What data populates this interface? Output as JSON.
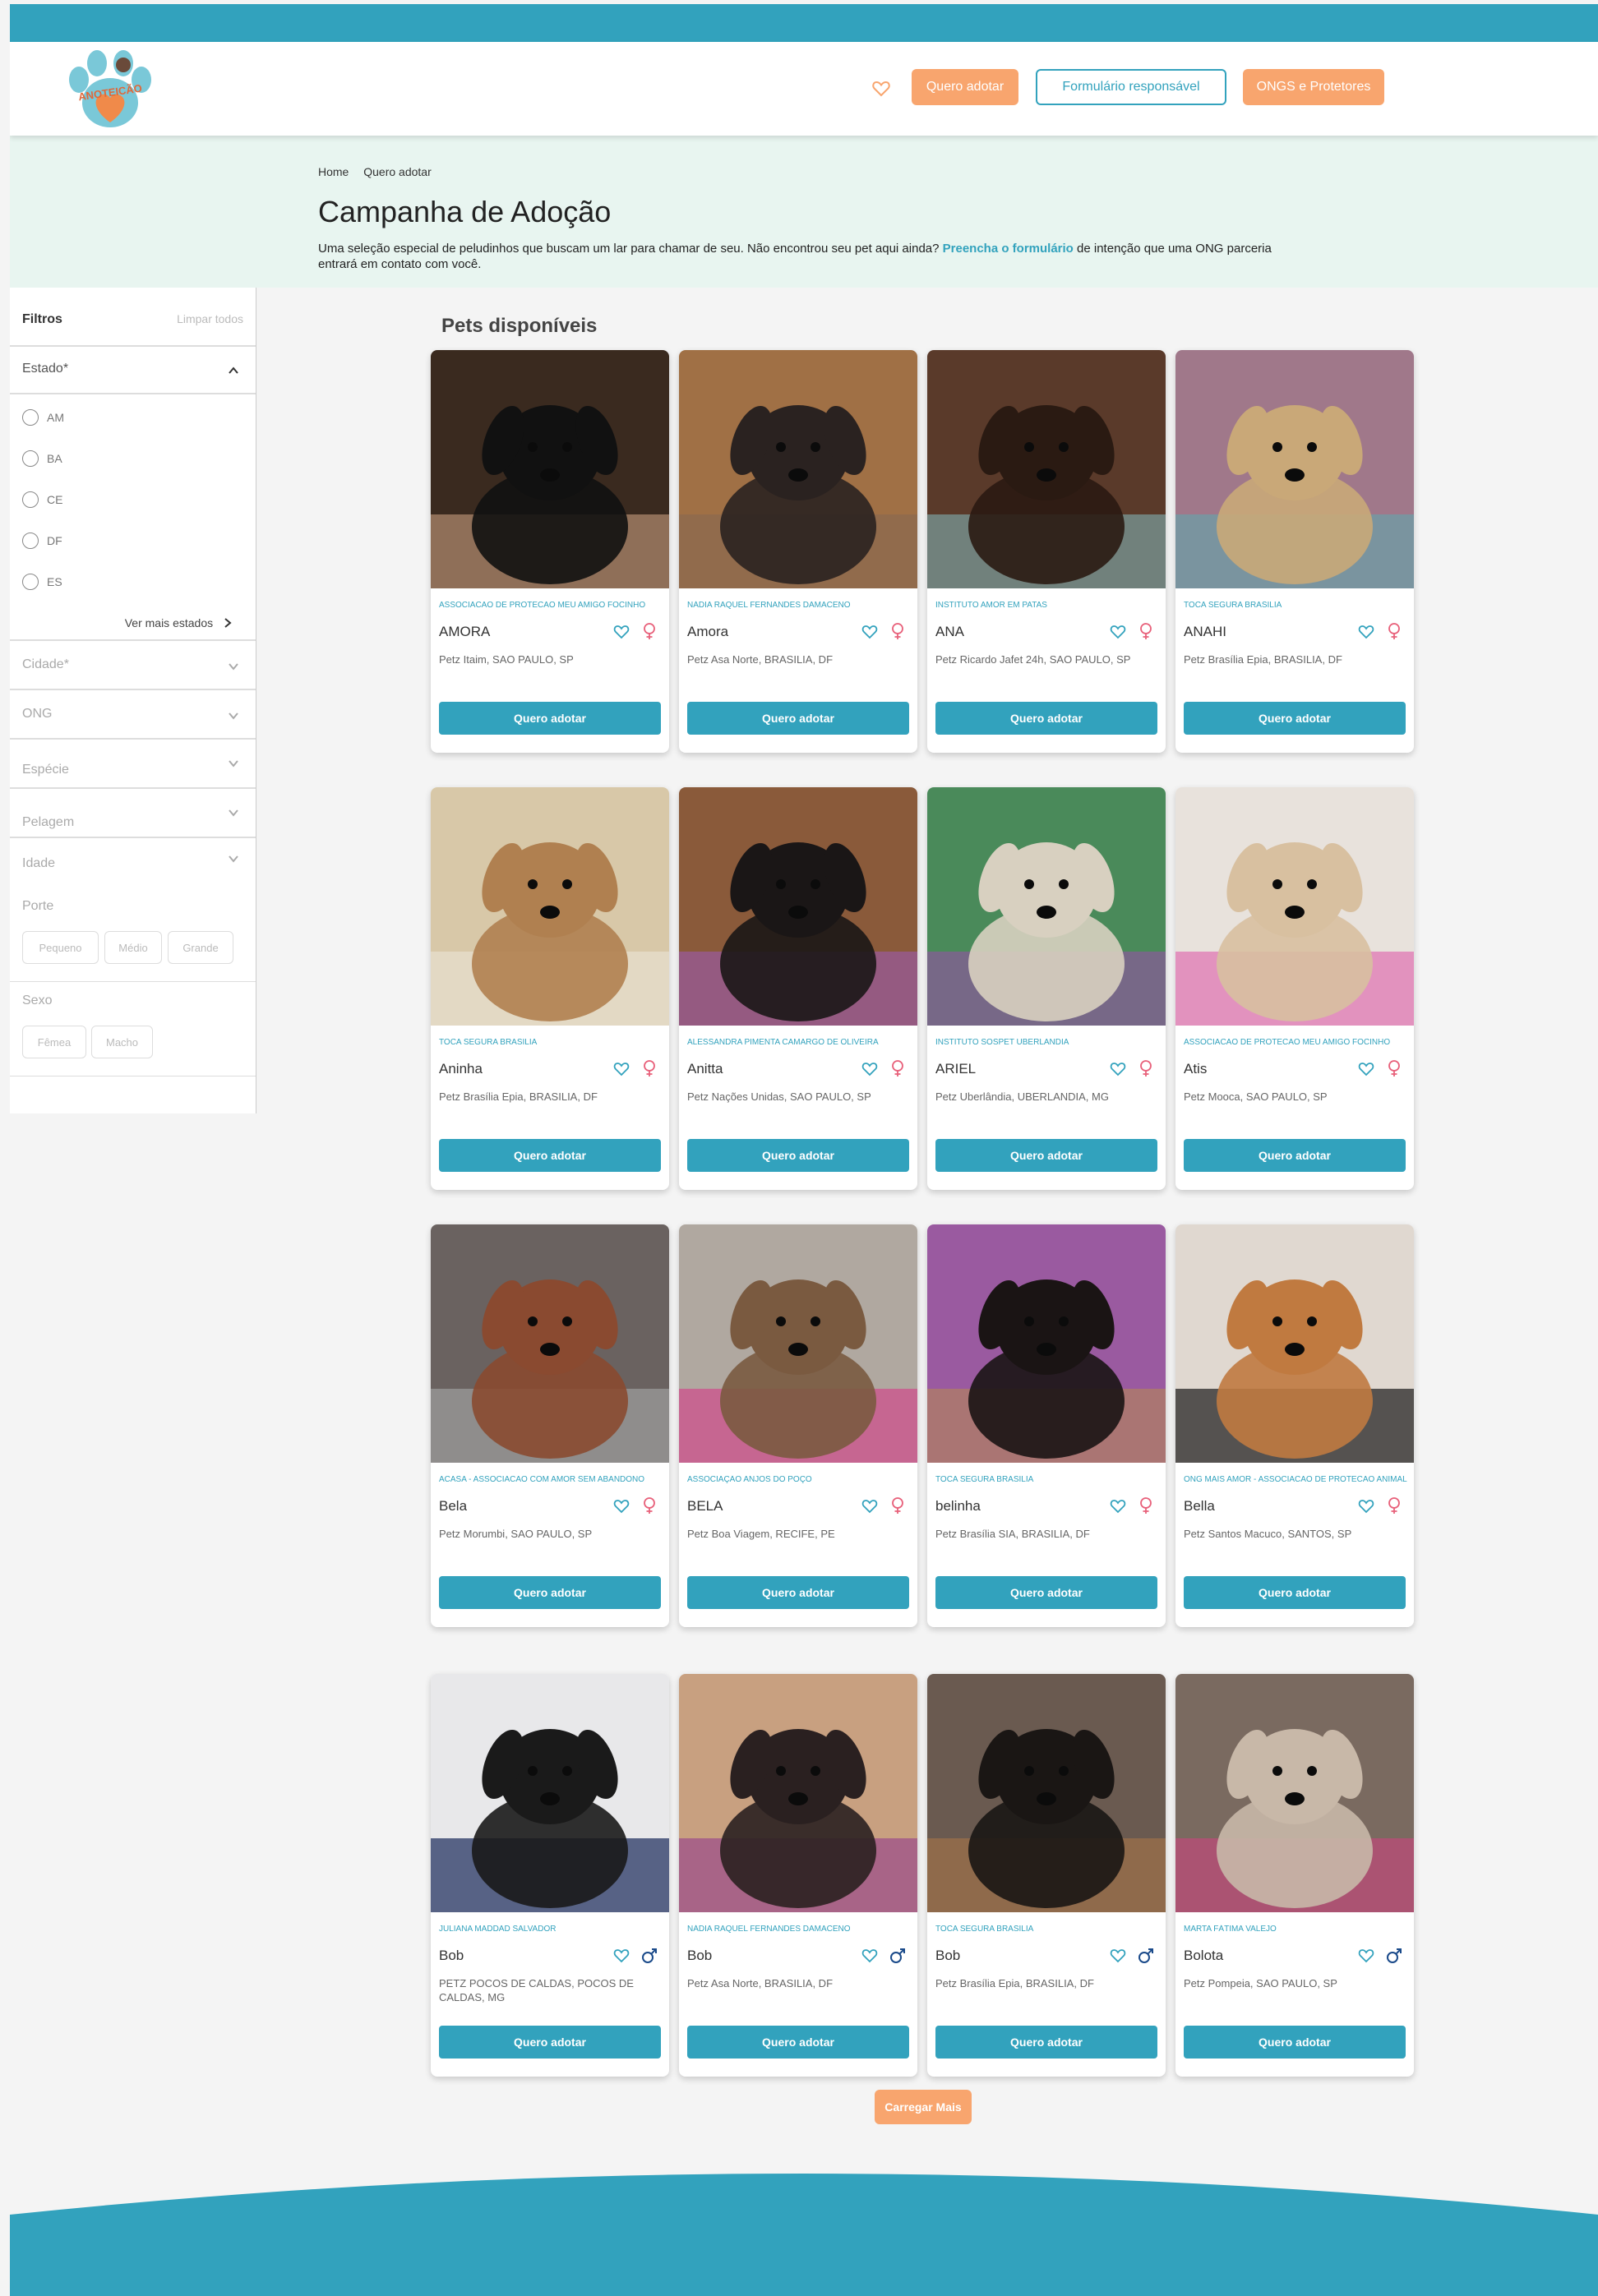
{
  "header": {
    "brand": "ANOTEICÃO",
    "nav": [
      "Quero adotar",
      "Formulário responsável",
      "ONGS e Protetores"
    ],
    "colors": {
      "primary": "#32a2bd",
      "accent": "#f8a56e",
      "hero_bg": "#e8f5f0"
    }
  },
  "breadcrumb": [
    "Home",
    "Quero adotar"
  ],
  "hero": {
    "title": "Campanha de Adoção",
    "text_before": "Uma seleção especial de peludinhos que buscam um lar para chamar de seu. Não encontrou seu pet aqui ainda? ",
    "link": "Preencha o formulário",
    "text_after": " de intenção que uma ONG parceria entrará em contato com você."
  },
  "filters": {
    "title": "Filtros",
    "clear": "Limpar todos",
    "estado_label": "Estado*",
    "states": [
      "AM",
      "BA",
      "CE",
      "DF",
      "ES"
    ],
    "more_states": "Ver mais estados",
    "cidade": "Cidade*",
    "ong": "ONG",
    "especie": "Espécie",
    "pelagem": "Pelagem",
    "idade": "Idade",
    "porte_label": "Porte",
    "porte": [
      "Pequeno",
      "Médio",
      "Grande"
    ],
    "sexo_label": "Sexo",
    "sexo": [
      "Fêmea",
      "Macho"
    ]
  },
  "section_title": "Pets disponíveis",
  "adopt_label": "Quero adotar",
  "load_more": "Carregar Mais",
  "pets": [
    {
      "org": "ASSOCIACAO DE PROTECAO MEU AMIGO FOCINHO",
      "name": "AMORA",
      "location": "Petz Itaim, SAO PAULO, SP",
      "sex": "female",
      "photo": [
        "#3a2a1f",
        "#111111",
        "#b48d70"
      ]
    },
    {
      "org": "NÁDIA RAQUEL FERNANDES DAMACENO",
      "name": "Amora",
      "location": "Petz Asa Norte, BRASILIA, DF",
      "sex": "female",
      "photo": [
        "#a07045",
        "#2a2220",
        "#8a6a50"
      ]
    },
    {
      "org": "INSTITUTO AMOR EM PATAS",
      "name": "ANA",
      "location": "Petz Ricardo Jafet 24h, SAO PAULO, SP",
      "sex": "female",
      "photo": [
        "#5a3a2a",
        "#2a1a12",
        "#7aa0a0"
      ]
    },
    {
      "org": "TOCA SEGURA BRASILIA",
      "name": "ANAHI",
      "location": "Petz Brasília Epia, BRASILIA, DF",
      "sex": "female",
      "photo": [
        "#a0788a",
        "#c9a878",
        "#6aa0a8"
      ]
    },
    {
      "org": "TOCA SEGURA BRASILIA",
      "name": "Aninha",
      "location": "Petz Brasília Epia, BRASILIA, DF",
      "sex": "female",
      "photo": [
        "#d8c8a8",
        "#b08050",
        "#e8e0d0"
      ]
    },
    {
      "org": "ALESSANDRA PIMENTA CAMARGO DE OLIVEIRA",
      "name": "Anitta",
      "location": "Petz Nações Unidas, SAO PAULO, SP",
      "sex": "female",
      "photo": [
        "#8a5a3a",
        "#1a1616",
        "#9a5aa0"
      ]
    },
    {
      "org": "INSTITUTO SOSPET UBERLANDIA",
      "name": "ARIEL",
      "location": "Petz Uberlândia, UBERLANDIA, MG",
      "sex": "female",
      "photo": [
        "#4a8a5a",
        "#d8d0c0",
        "#8a5a9a"
      ]
    },
    {
      "org": "ASSOCIACAO DE PROTECAO MEU AMIGO FOCINHO",
      "name": "Atis",
      "location": "Petz Mooca, SAO PAULO, SP",
      "sex": "female",
      "photo": [
        "#e8e2dc",
        "#d8c0a0",
        "#e070b0"
      ]
    },
    {
      "org": "ACASA - ASSOCIACAO COM AMOR SEM ABANDONO",
      "name": "Bela",
      "location": "Petz Morumbi, SAO PAULO, SP",
      "sex": "female",
      "photo": [
        "#6a6260",
        "#8a4a30",
        "#a0a0a0"
      ]
    },
    {
      "org": "ASSOCIAÇÃO ANJOS DO POÇO",
      "name": "BELA",
      "location": "Petz Boa Viagem, RECIFE, PE",
      "sex": "female",
      "photo": [
        "#b0a8a0",
        "#7a5a40",
        "#d04a8a"
      ]
    },
    {
      "org": "TOCA SEGURA BRASILIA",
      "name": "belinha",
      "location": "Petz Brasília SIA, BRASILIA, DF",
      "sex": "female",
      "photo": [
        "#9a5aa0",
        "#1a1414",
        "#b08060"
      ]
    },
    {
      "org": "ONG MAIS AMOR - ASSOCIACAO DE PROTECAO ANIMAL",
      "name": "Bella",
      "location": "Petz Santos Macuco, SANTOS, SP",
      "sex": "female",
      "photo": [
        "#e0d8d0",
        "#c07a40",
        "#1a1a1a"
      ]
    },
    {
      "org": "JULIANA MADDAD SALVADOR",
      "name": "Bob",
      "location": "PETZ POCOS DE CALDAS, POCOS DE CALDAS, MG",
      "sex": "male",
      "photo": [
        "#e8e8ea",
        "#1a1a1a",
        "#1a2a5a"
      ]
    },
    {
      "org": "NÁDIA RAQUEL FERNANDES DAMACENO",
      "name": "Bob",
      "location": "Petz Asa Norte, BRASILIA, DF",
      "sex": "male",
      "photo": [
        "#c8a080",
        "#2a2020",
        "#9a4a8a"
      ]
    },
    {
      "org": "TOCA SEGURA BRASILIA",
      "name": "Bob",
      "location": "Petz Brasília Epia, BRASILIA, DF",
      "sex": "male",
      "photo": [
        "#6a5a50",
        "#1a1614",
        "#a07048"
      ]
    },
    {
      "org": "MARTA FÁTIMA VALEJO",
      "name": "Bolota",
      "location": "Petz Pompeia, SAO PAULO, SP",
      "sex": "male",
      "photo": [
        "#7a6a60",
        "#c8b8a8",
        "#c04a7a"
      ]
    }
  ]
}
